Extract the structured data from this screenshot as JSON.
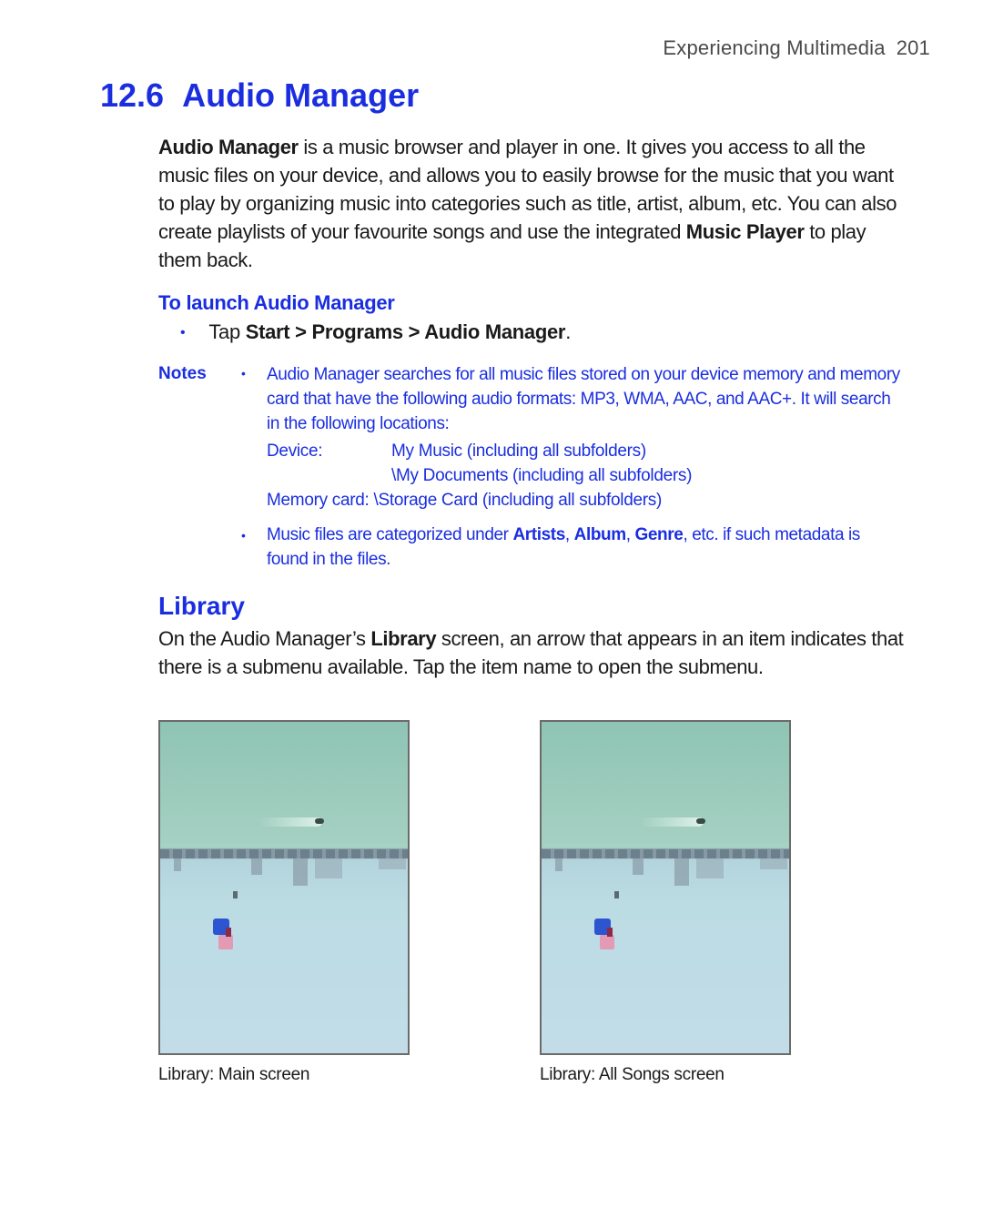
{
  "header": {
    "chapter_title": "Experiencing Multimedia",
    "page_number": "201"
  },
  "section": {
    "number": "12.6",
    "title": "Audio Manager"
  },
  "intro": {
    "bold_lead": "Audio Manager",
    "text_1": " is a music browser and player in one. It gives you access to all the music files on your device, and allows you to easily browse for the music that you want to play by organizing music into categories such as title, artist, album, etc. You can also create playlists of your favourite songs and use the integrated ",
    "bold_2": "Music Player",
    "text_2": " to play them back."
  },
  "launch": {
    "heading": "To launch Audio Manager",
    "bullet": "•",
    "step_prefix": "Tap ",
    "step_start": "Start",
    "separator": " > ",
    "step_programs": "Programs",
    "step_app": "Audio Manager",
    "step_end": "."
  },
  "notes": {
    "label": "Notes",
    "bullet": "•",
    "note_1": "Audio Manager searches for all music files stored on your device memory and memory card that have the following audio formats: MP3, WMA, AAC, and AAC+. It will search in the following locations:",
    "locations": [
      {
        "label": "Device:",
        "path": "My Music (including all subfolders)"
      },
      {
        "label": "",
        "path": "\\My Documents (including all subfolders)"
      },
      {
        "label": "Memory card:",
        "path": "\\Storage Card (including all subfolders)"
      }
    ],
    "note_2_prefix": "Music files are categorized under ",
    "note_2_artists": "Artists",
    "note_2_comma": ", ",
    "note_2_album": "Album",
    "note_2_genre": "Genre",
    "note_2_suffix": ", etc. if such metadata is found in the files."
  },
  "library": {
    "title": "Library",
    "text_1": "On the Audio Manager’s ",
    "bold": "Library",
    "text_2": " screen, an arrow that appears in an item indicates that there is a submenu available. Tap the item name to open the submenu."
  },
  "figures": [
    {
      "caption": "Library: Main screen"
    },
    {
      "caption": "Library: All Songs screen"
    }
  ]
}
